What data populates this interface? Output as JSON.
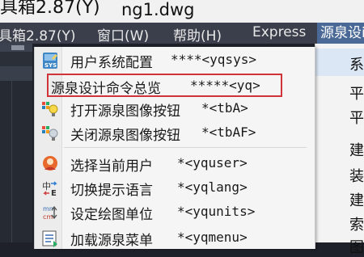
{
  "titlebar": {
    "left_fragment": "具箱2.87(Y)",
    "filename": "ng1.dwg"
  },
  "menubar": {
    "items": [
      {
        "label": "具箱2.87(Y)"
      },
      {
        "label": "窗口(W)"
      },
      {
        "label": "帮助(H)"
      },
      {
        "label": "Express"
      },
      {
        "label": "源泉设i"
      }
    ]
  },
  "menu": {
    "items": [
      {
        "label": "用户系统配置",
        "command": "****<yqsys>",
        "icon": "sys-config-icon"
      },
      {
        "label": "源泉设计命令总览",
        "command": "*****<yq>",
        "icon": "none",
        "highlighted": true
      },
      {
        "label": "打开源泉图像按钮",
        "command": "*<tbA>",
        "icon": "bulb-on-icon"
      },
      {
        "label": "关闭源泉图像按钮",
        "command": "*<tbAF>",
        "icon": "bulb-off-icon"
      },
      {
        "label": "选择当前用户",
        "command": "*<yquser>",
        "icon": "user-icon"
      },
      {
        "label": "切换提示语言",
        "command": "*<yqlang>",
        "icon": "language-switch-icon"
      },
      {
        "label": "设定绘图单位",
        "command": "*<yqunits>",
        "icon": "units-icon"
      },
      {
        "label": "加载源泉菜单",
        "command": "*<yqmenu>",
        "icon": "load-menu-icon"
      }
    ]
  },
  "submenu_strip": {
    "items": [
      {
        "label": "系"
      },
      {
        "label": "平"
      },
      {
        "label": "平"
      },
      {
        "label": "建"
      },
      {
        "label": "装"
      },
      {
        "label": "建"
      },
      {
        "label": "索"
      },
      {
        "label": "图"
      }
    ]
  },
  "colors": {
    "highlight_border": "#d0343a",
    "menu_active": "#4a6996"
  }
}
